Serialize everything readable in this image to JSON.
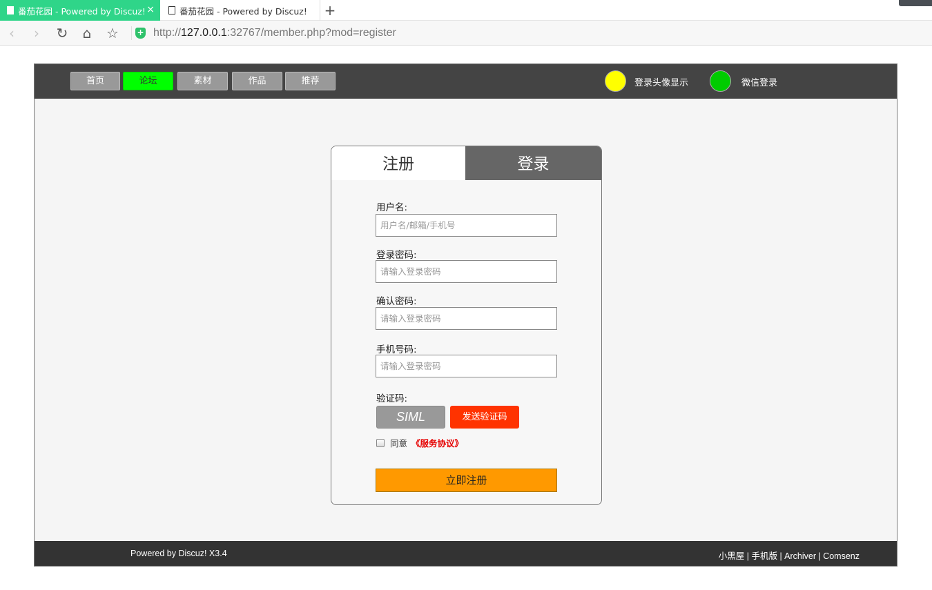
{
  "browser": {
    "active_tab": "番茄花园 - Powered by Discuz!",
    "inactive_tab": "番茄花园 - Powered by Discuz!",
    "new_tab": "+",
    "close_tab": "×",
    "url_prefix": "http://",
    "url_host": "127.0.0.1",
    "url_rest": ":32767/member.php?mod=register",
    "nav_back": "‹",
    "nav_forward": "›",
    "nav_reload": "↻",
    "nav_home": "⌂",
    "nav_star": "☆",
    "shield": "+"
  },
  "topnav": {
    "items": [
      {
        "label": "首页",
        "active": false
      },
      {
        "label": "论坛",
        "active": true
      },
      {
        "label": "素材",
        "active": false
      },
      {
        "label": "作品",
        "active": false
      },
      {
        "label": "推荐",
        "active": false
      }
    ],
    "avatar_label": "登录头像显示",
    "wechat_label": "微信登录",
    "colors": {
      "active": "#00ff00",
      "yellow_circle": "#ffff00",
      "green_circle": "#00cc00"
    }
  },
  "register": {
    "tab_register": "注册",
    "tab_login": "登录",
    "username_label": "用户名:",
    "username_placeholder": "用户名/邮箱/手机号",
    "password_label": "登录密码:",
    "password_placeholder": "请输入登录密码",
    "confirm_label": "确认密码:",
    "confirm_placeholder": "请输入登录密码",
    "phone_label": "手机号码:",
    "phone_placeholder": "请输入登录密码",
    "code_label": "验证码:",
    "captcha_text": "SIML",
    "send_code": "发送验证码",
    "agree_text": "同意",
    "tos_text": "《服务协议》",
    "submit": "立即注册",
    "colors": {
      "send_code": "#ff3300",
      "submit": "#ff9900",
      "tos": "#e60000"
    }
  },
  "footer": {
    "powered": "Powered by Discuz! X3.4",
    "links": "小黑屋 | 手机版 | Archiver | Comsenz"
  }
}
